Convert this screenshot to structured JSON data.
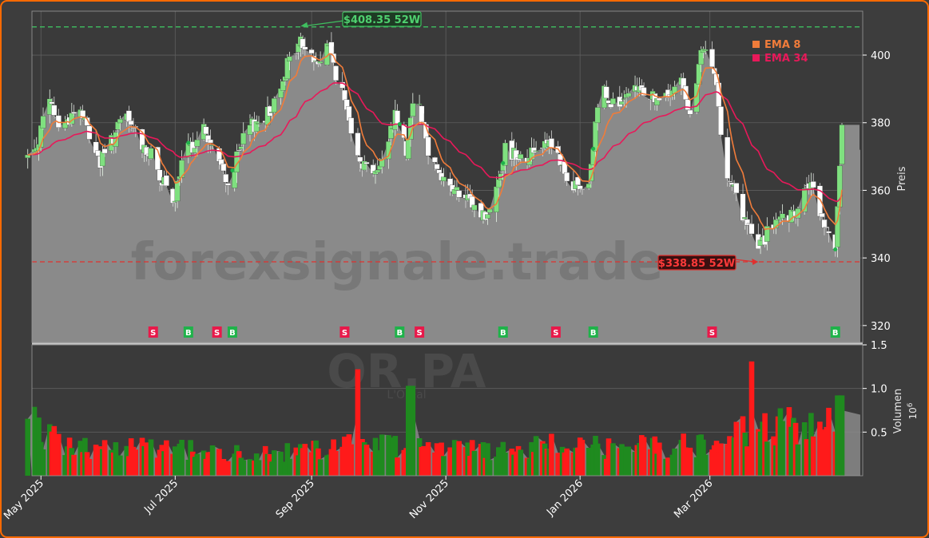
{
  "chart_data": {
    "type": "candlestick",
    "watermark": "forexsignale.trade",
    "symbol": "OR.PA",
    "company": "L'Oréal",
    "ylabel_price": "Preis",
    "ylabel_volume": "Volumen",
    "volume_scale_label": "10",
    "volume_scale_exp": "6",
    "price_ylim": [
      315,
      413
    ],
    "volume_ylim": [
      0,
      1.5
    ],
    "price_ticks": [
      "320",
      "340",
      "360",
      "380",
      "400"
    ],
    "volume_ticks": [
      "0.5",
      "1.0",
      "1.5"
    ],
    "x_ticks": [
      {
        "date": "2025-05-01",
        "label": "May 2025"
      },
      {
        "date": "2025-07-01",
        "label": "Jul 2025"
      },
      {
        "date": "2025-09-01",
        "label": "Sep 2025"
      },
      {
        "date": "2025-11-01",
        "label": "Nov 2025"
      },
      {
        "date": "2026-01-01",
        "label": "Jan 2026"
      },
      {
        "date": "2026-03-01",
        "label": "Mar 2026"
      }
    ],
    "legend": [
      {
        "name": "EMA 8",
        "color": "#f07c3a"
      },
      {
        "name": "EMA 34",
        "color": "#e8195a"
      }
    ],
    "high_52w": {
      "value": 408.35,
      "label": "$408.35 52W",
      "date": "2025-08-27",
      "color": "#3fbf5f"
    },
    "low_52w": {
      "value": 338.85,
      "label": "$338.85 52W",
      "date": "2026-03-23",
      "color": "#e0302f"
    },
    "signals": [
      {
        "type": "S",
        "date": "2025-06-21"
      },
      {
        "type": "B",
        "date": "2025-07-07"
      },
      {
        "type": "S",
        "date": "2025-07-20"
      },
      {
        "type": "B",
        "date": "2025-07-27"
      },
      {
        "type": "S",
        "date": "2025-09-16"
      },
      {
        "type": "B",
        "date": "2025-10-11"
      },
      {
        "type": "S",
        "date": "2025-10-20"
      },
      {
        "type": "B",
        "date": "2025-11-27"
      },
      {
        "type": "S",
        "date": "2025-12-21"
      },
      {
        "type": "B",
        "date": "2026-01-07"
      },
      {
        "type": "S",
        "date": "2026-03-02"
      },
      {
        "type": "B",
        "date": "2026-04-27"
      }
    ],
    "close_keypoints": [
      [
        "2025-04-27",
        370
      ],
      [
        "2025-05-05",
        386
      ],
      [
        "2025-05-10",
        378
      ],
      [
        "2025-05-18",
        385
      ],
      [
        "2025-05-28",
        368
      ],
      [
        "2025-06-08",
        382
      ],
      [
        "2025-06-22",
        368
      ],
      [
        "2025-06-30",
        355
      ],
      [
        "2025-07-05",
        370
      ],
      [
        "2025-07-14",
        378
      ],
      [
        "2025-07-25",
        362
      ],
      [
        "2025-08-03",
        378
      ],
      [
        "2025-08-13",
        383
      ],
      [
        "2025-08-20",
        396
      ],
      [
        "2025-08-27",
        404
      ],
      [
        "2025-09-04",
        397
      ],
      [
        "2025-09-08",
        404
      ],
      [
        "2025-09-15",
        388
      ],
      [
        "2025-09-24",
        368
      ],
      [
        "2025-10-02",
        366
      ],
      [
        "2025-10-09",
        383
      ],
      [
        "2025-10-14",
        372
      ],
      [
        "2025-10-18",
        392
      ],
      [
        "2025-10-24",
        372
      ],
      [
        "2025-11-01",
        362
      ],
      [
        "2025-11-08",
        358
      ],
      [
        "2025-11-20",
        352
      ],
      [
        "2025-11-28",
        372
      ],
      [
        "2025-12-08",
        370
      ],
      [
        "2025-12-18",
        376
      ],
      [
        "2025-12-26",
        362
      ],
      [
        "2026-01-05",
        360
      ],
      [
        "2026-01-10",
        392
      ],
      [
        "2026-01-18",
        384
      ],
      [
        "2026-01-28",
        390
      ],
      [
        "2026-02-08",
        386
      ],
      [
        "2026-02-16",
        392
      ],
      [
        "2026-02-20",
        384
      ],
      [
        "2026-02-26",
        402
      ],
      [
        "2026-03-03",
        394
      ],
      [
        "2026-03-08",
        368
      ],
      [
        "2026-03-16",
        352
      ],
      [
        "2026-03-23",
        343
      ],
      [
        "2026-03-30",
        350
      ],
      [
        "2026-04-08",
        352
      ],
      [
        "2026-04-15",
        362
      ],
      [
        "2026-04-23",
        348
      ],
      [
        "2026-04-27",
        345
      ],
      [
        "2026-04-30",
        378
      ]
    ],
    "volume_keypoints": [
      [
        "2025-04-27",
        0.6
      ],
      [
        "2025-05-15",
        0.34
      ],
      [
        "2025-06-22",
        0.38
      ],
      [
        "2025-07-20",
        0.26
      ],
      [
        "2025-08-27",
        0.28
      ],
      [
        "2025-09-20",
        0.42
      ],
      [
        "2025-10-20",
        0.36
      ],
      [
        "2025-11-20",
        0.3
      ],
      [
        "2025-12-20",
        0.36
      ],
      [
        "2026-01-20",
        0.34
      ],
      [
        "2026-02-20",
        0.36
      ],
      [
        "2026-03-20",
        0.55
      ],
      [
        "2026-04-30",
        0.7
      ]
    ],
    "volume_spikes": [
      {
        "date": "2025-09-21",
        "value": 1.22
      },
      {
        "date": "2025-10-16",
        "value": 1.03
      },
      {
        "date": "2026-03-21",
        "value": 1.31
      },
      {
        "date": "2026-04-29",
        "value": 0.92
      }
    ]
  }
}
